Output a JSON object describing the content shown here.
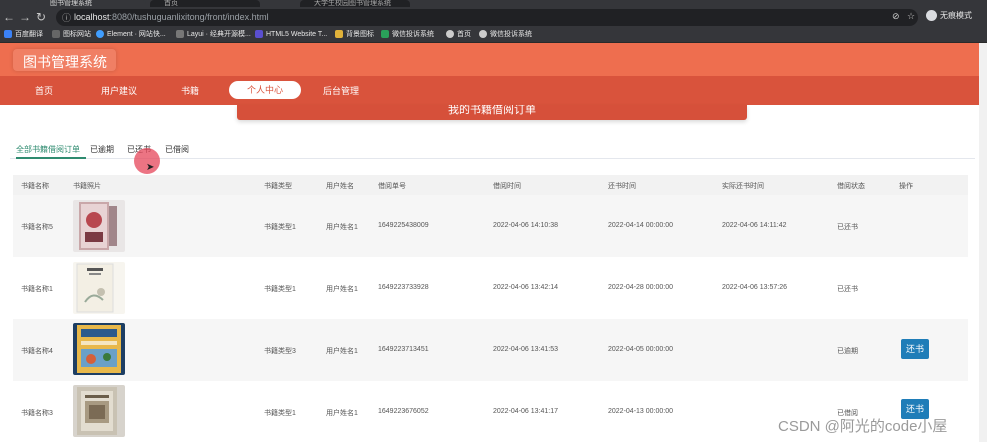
{
  "browser": {
    "tabs": [
      "图书管理系统",
      "首页",
      "大学生校园图书管理系统"
    ],
    "url_host": "localhost",
    "url_rest": ":8080/tushuguanlixitong/front/index.html",
    "incognito_label": "无痕模式",
    "bookmarks": [
      "百度翻译",
      "图标网站",
      "Element · 网站快...",
      "Layui · 经典开源模...",
      "HTML5 Website T...",
      "背景图标",
      "微信投诉系统",
      "首页",
      "微信投诉系统"
    ]
  },
  "site": {
    "title": "图书管理系统",
    "nav": [
      "首页",
      "用户建议",
      "书籍",
      "个人中心",
      "后台管理"
    ],
    "banner": "我的书籍借阅订单"
  },
  "subtabs": [
    "全部书籍借阅订单",
    "已逾期",
    "已还书",
    "已借阅"
  ],
  "table": {
    "headers": [
      "书籍名称",
      "书籍照片",
      "书籍类型",
      "用户姓名",
      "借阅单号",
      "借阅时间",
      "还书时间",
      "实际还书时间",
      "借阅状态",
      "操作"
    ],
    "rows": [
      {
        "name": "书籍名称5",
        "type": "书籍类型1",
        "user": "用户姓名1",
        "order": "1649225438009",
        "borrow": "2022-04-06 14:10:38",
        "due": "2022-04-14 00:00:00",
        "actual": "2022-04-06 14:11:42",
        "status": "已还书",
        "action": ""
      },
      {
        "name": "书籍名称1",
        "type": "书籍类型1",
        "user": "用户姓名1",
        "order": "1649223733928",
        "borrow": "2022-04-06 13:42:14",
        "due": "2022-04-28 00:00:00",
        "actual": "2022-04-06 13:57:26",
        "status": "已还书",
        "action": ""
      },
      {
        "name": "书籍名称4",
        "type": "书籍类型3",
        "user": "用户姓名1",
        "order": "1649223713451",
        "borrow": "2022-04-06 13:41:53",
        "due": "2022-04-05 00:00:00",
        "actual": "",
        "status": "已逾期",
        "action": "还书"
      },
      {
        "name": "书籍名称3",
        "type": "书籍类型1",
        "user": "用户姓名1",
        "order": "1649223676052",
        "borrow": "2022-04-06 13:41:17",
        "due": "2022-04-13 00:00:00",
        "actual": "",
        "status": "已借阅",
        "action": "还书"
      }
    ]
  },
  "watermark": "CSDN @阿光的code小屋",
  "colors": {
    "header": "#ee6e4f",
    "nav": "#d9533c",
    "accent_green": "#2e8b6f",
    "button_blue": "#1f7db8"
  }
}
